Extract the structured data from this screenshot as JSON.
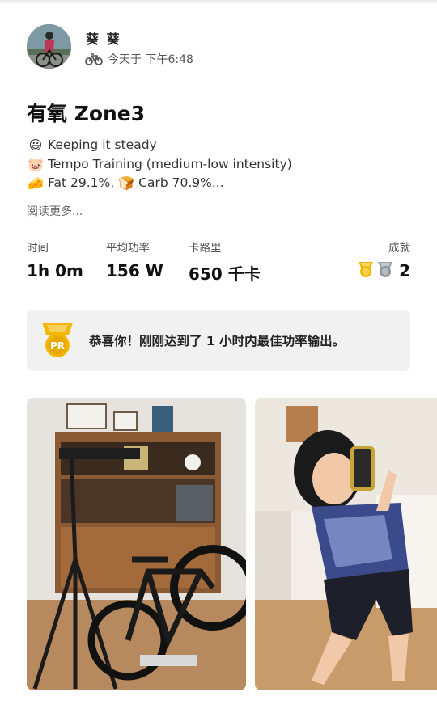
{
  "activity": {
    "athlete_name": "葵 葵",
    "timestamp": "今天于 下午6:48",
    "sport_icon": "bike-icon",
    "title": "有氧 Zone3",
    "description": [
      {
        "emoji": "😃",
        "text": "Keeping it steady"
      },
      {
        "emoji": "🐷",
        "text": "Tempo Training (medium-low intensity)"
      },
      {
        "emoji": "🧀",
        "text": "Fat 29.1%,",
        "emoji2": "🍞",
        "text2": "Carb 70.9%..."
      }
    ],
    "read_more": "阅读更多..."
  },
  "stats": {
    "time": {
      "label": "时间",
      "value": "1h 0m"
    },
    "avg_power": {
      "label": "平均功率",
      "value": "156 W"
    },
    "calories": {
      "label": "卡路里",
      "value": "650 千卡"
    },
    "achievements": {
      "label": "成就",
      "value": "2"
    }
  },
  "pr_card": {
    "badge": "PR",
    "message": "恭喜你！刚刚达到了 1 小时内最佳功率输出。"
  },
  "colors": {
    "gold": "#f2b705",
    "silver": "#9aa1a8",
    "card_bg": "#f1f1f1"
  }
}
